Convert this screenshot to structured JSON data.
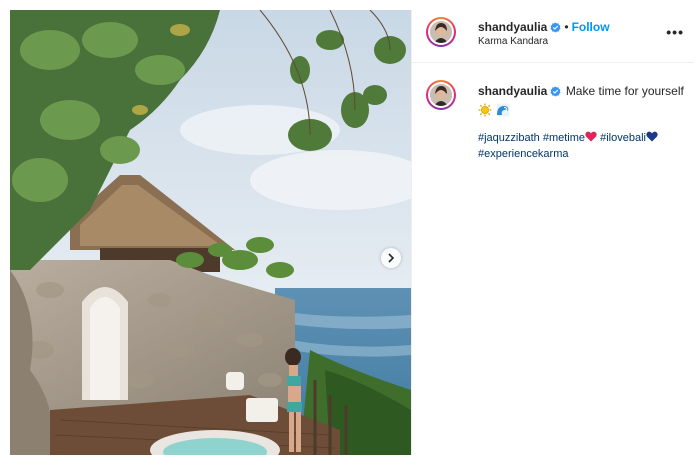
{
  "post": {
    "username": "shandyaulia",
    "follow_label": "Follow",
    "separator": "•",
    "location": "Karma Kandara",
    "more_label": "•••"
  },
  "caption": {
    "username": "shandyaulia",
    "text": "Make time for yourself",
    "emojis": [
      "sun-emoji",
      "wave-emoji"
    ],
    "hashtags": [
      {
        "text": "#jaquzzibath",
        "emoji": ""
      },
      {
        "text": "#metime",
        "emoji": "red-heart-emoji"
      },
      {
        "text": "#ilovebali",
        "emoji": "blue-heart-emoji"
      },
      {
        "text": "#experiencekarma",
        "emoji": ""
      }
    ]
  },
  "colors": {
    "link": "#0095f6",
    "hashtag": "#00376b",
    "verified": "#3897f0",
    "sea": "#5b8fb0"
  }
}
